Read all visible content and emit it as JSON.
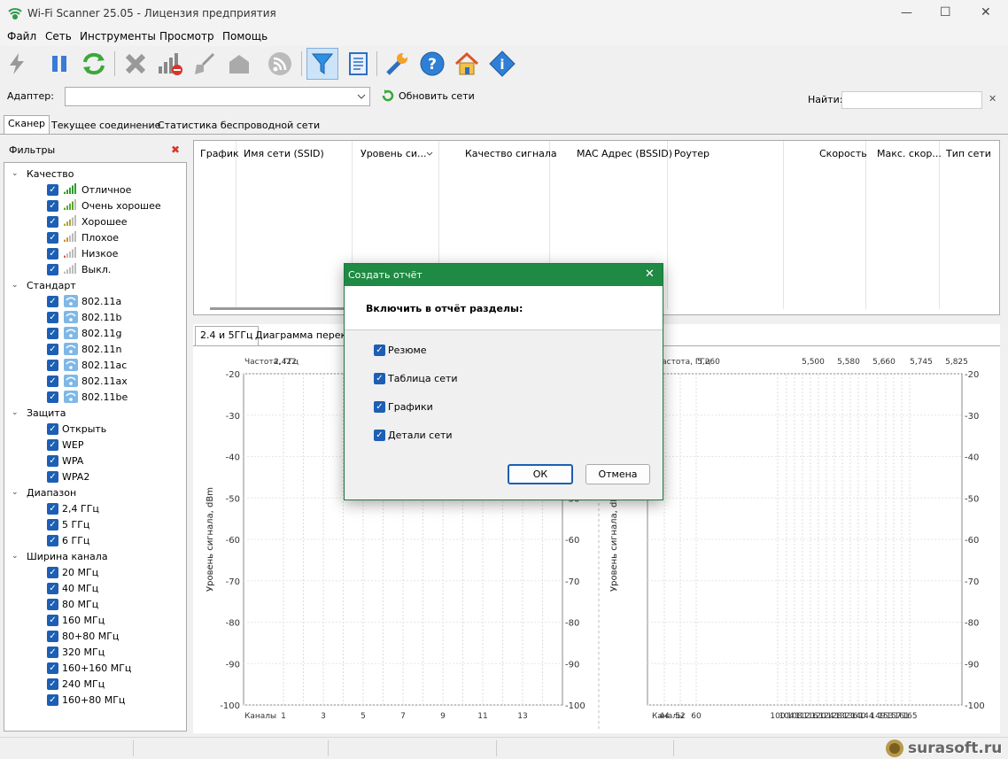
{
  "window": {
    "title": "Wi-Fi Scanner 25.05 - Лицензия предприятия",
    "minimize": "—",
    "maximize": "☐",
    "close": "✕"
  },
  "menu": [
    "Файл",
    "Сеть",
    "Инструменты",
    "Просмотр",
    "Помощь"
  ],
  "toolbar_icons": [
    "lightning-icon",
    "pause-icon",
    "refresh-icon",
    "delete-icon",
    "signal-remove-icon",
    "brush-icon",
    "clipboard-icon",
    "rss-icon",
    "filter-icon",
    "notebook-icon",
    "wrench-icon",
    "help-icon",
    "home-icon",
    "info-icon"
  ],
  "adapter": {
    "label": "Адаптер:",
    "value": "",
    "refresh": "Обновить сети"
  },
  "search": {
    "label": "Найти:",
    "value": ""
  },
  "tabs": [
    "Сканер",
    "Текущее соединение",
    "Статистика беспроводной сети"
  ],
  "filters": {
    "title": "Фильтры",
    "clear": "✖",
    "groups": [
      {
        "label": "Качество",
        "items": [
          "Отличное",
          "Очень хорошее",
          "Хорошее",
          "Плохое",
          "Низкое",
          "Выкл."
        ]
      },
      {
        "label": "Стандарт",
        "items": [
          "802.11a",
          "802.11b",
          "802.11g",
          "802.11n",
          "802.11ac",
          "802.11ax",
          "802.11be"
        ]
      },
      {
        "label": "Защита",
        "items": [
          "Открыть",
          "WEP",
          "WPA",
          "WPA2"
        ]
      },
      {
        "label": "Диапазон",
        "items": [
          "2,4 ГГц",
          "5 ГГц",
          "6 ГГц"
        ]
      },
      {
        "label": "Ширина канала",
        "items": [
          "20 МГц",
          "40 МГц",
          "80 МГц",
          "160 МГц",
          "80+80 МГц",
          "320 МГц",
          "160+160 МГц",
          "240 МГц",
          "160+80 МГц"
        ]
      }
    ]
  },
  "grid": {
    "columns": [
      "График",
      "Имя сети (SSID)",
      "Уровень си...",
      "Качество сигнала",
      "MAC Адрес (BSSID)",
      "Роутер",
      "Скорость",
      "Макс. скор...",
      "Тип сети"
    ]
  },
  "chart_tabs": [
    "2.4 и 5ГГц",
    "Диаграмма перекр"
  ],
  "chart_data": [
    {
      "type": "line",
      "title": "",
      "x_top_label": "Частота, ГГц",
      "x_top_ticks": [
        "2,422"
      ],
      "xlabel": "Каналы",
      "x_ticks": [
        "1",
        "3",
        "5",
        "7",
        "9",
        "11",
        "13"
      ],
      "ylabel": "Уровень сигнала, dBm",
      "ylim": [
        -100,
        -20
      ],
      "y_ticks": [
        -20,
        -30,
        -40,
        -50,
        -60,
        -70,
        -80,
        -90,
        -100
      ],
      "series": []
    },
    {
      "type": "line",
      "title": "",
      "x_top_label": "Частота, ГГц",
      "x_top_ticks": [
        "5,260",
        "5,500",
        "5,580",
        "5,660",
        "5,745",
        "5,825"
      ],
      "xlabel": "Каналы",
      "x_ticks": [
        "44",
        "52",
        "60",
        "100",
        "104",
        "108",
        "112",
        "116",
        "120",
        "124",
        "128",
        "132",
        "136",
        "140",
        "144",
        "149",
        "153",
        "157",
        "161",
        "165"
      ],
      "ylabel": "Уровень сигнала, dBm",
      "ylim": [
        -100,
        -20
      ],
      "y_ticks": [
        -20,
        -30,
        -40,
        -50,
        -60,
        -70,
        -80,
        -90,
        -100
      ],
      "series": []
    }
  ],
  "dialog": {
    "title": "Создать отчёт",
    "heading": "Включить в отчёт разделы:",
    "options": [
      "Резюме",
      "Таблица сети",
      "Графики",
      "Детали сети"
    ],
    "ok": "ОК",
    "cancel": "Отмена"
  },
  "watermark": "surasoft.ru"
}
